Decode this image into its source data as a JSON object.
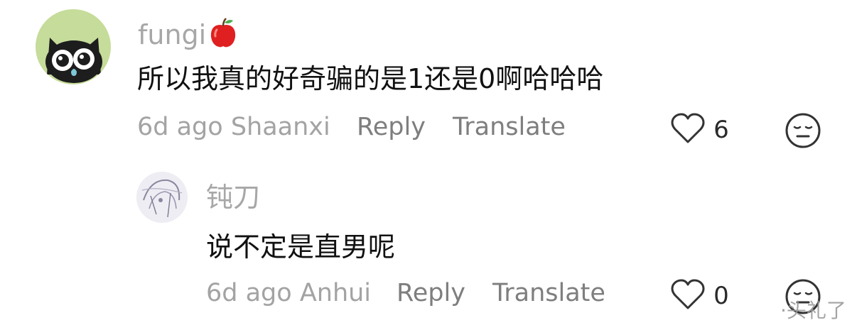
{
  "comments": [
    {
      "username": "fungi",
      "username_emoji": "apple-icon",
      "text": "所以我真的好奇骗的是1还是0啊哈哈哈",
      "meta": "6d ago Shaanxi",
      "reply_label": "Reply",
      "translate_label": "Translate",
      "like_count": "6"
    },
    {
      "username": "钝刀",
      "text": "说不定是直男呢",
      "meta": "6d ago Anhui",
      "reply_label": "Reply",
      "translate_label": "Translate",
      "like_count": "0"
    }
  ],
  "icons": {
    "like": "heart-outline-icon",
    "dislike": "meh-face-icon"
  },
  "watermark": "·头礼了",
  "colors": {
    "text_primary": "#111111",
    "text_secondary": "#a3a3a3",
    "action": "#7e7e7e",
    "apple_red": "#e02020"
  }
}
